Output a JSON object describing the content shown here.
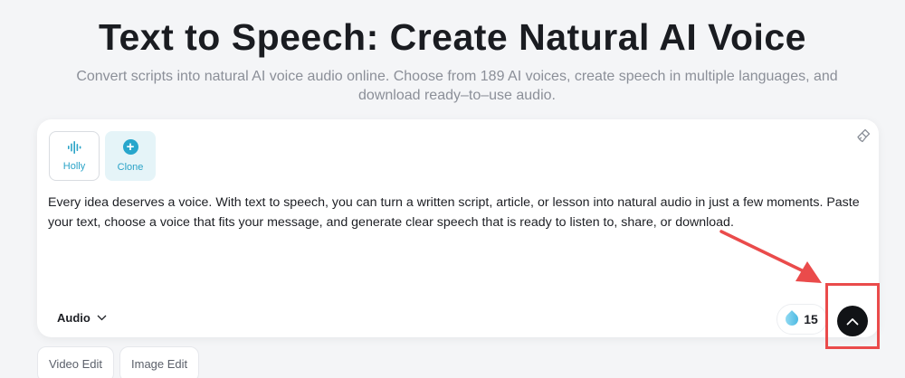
{
  "hero": {
    "title": "Text to Speech: Create Natural AI Voice",
    "subtitle": "Convert scripts into natural AI voice audio online. Choose from 189 AI voices, create speech in multiple languages, and download ready–to–use audio."
  },
  "voices": [
    {
      "label": "Holly",
      "icon": "waveform-icon"
    },
    {
      "label": "Clone",
      "icon": "plus-circle-icon"
    }
  ],
  "editor": {
    "text": "Every idea deserves a voice. With text to speech, you can turn a written script, article, or lesson into natural audio in just a few moments. Paste your text, choose a voice that fits your message, and generate clear speech that is ready to listen to, share, or download.",
    "clear_icon": "brush-icon"
  },
  "footer": {
    "output_type": "Audio",
    "credits": "15",
    "credits_icon": "droplet-icon",
    "submit_icon": "chevron-up-icon"
  },
  "tabs": [
    {
      "label": "Video Edit"
    },
    {
      "label": "Image Edit"
    }
  ],
  "annotation": {
    "color": "#ea4b4b"
  },
  "colors": {
    "accent": "#27a6cc",
    "submit": "#111316",
    "background": "#f4f5f7"
  }
}
